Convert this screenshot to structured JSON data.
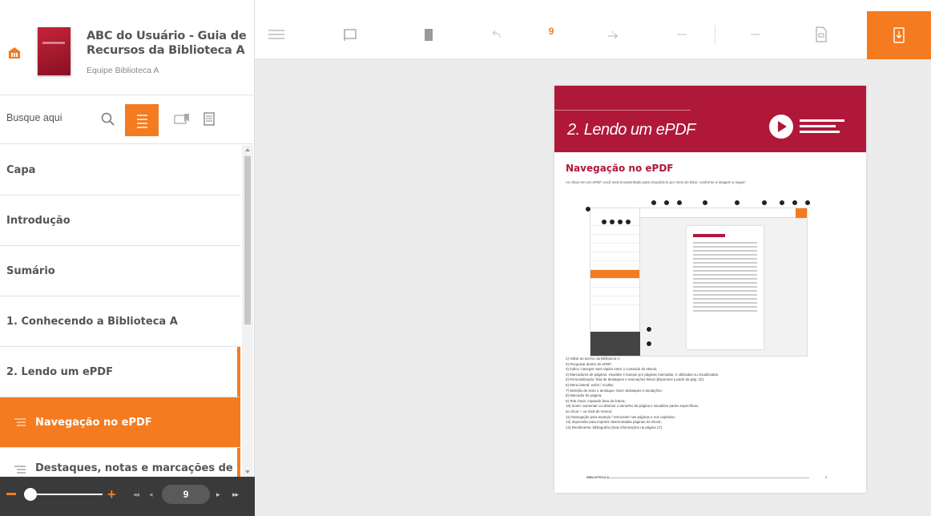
{
  "book": {
    "title": "ABC do Usuário - Guia de Recursos da Biblioteca A",
    "author": "Equipe Biblioteca A"
  },
  "search": {
    "placeholder": "Busque aqui"
  },
  "toc": {
    "items": [
      {
        "label": "Capa"
      },
      {
        "label": "Introdução"
      },
      {
        "label": "Sumário"
      },
      {
        "label": "1. Conhecendo a Biblioteca A"
      },
      {
        "label": "2. Lendo um ePDF"
      },
      {
        "label": "Navegação no ePDF"
      },
      {
        "label": "Destaques, notas e marcações de"
      }
    ]
  },
  "zoom": {
    "minus": "−",
    "plus": "+",
    "nav_first": "◂◂",
    "nav_prev": "◂",
    "nav_next": "▸",
    "nav_last": "▸▸"
  },
  "current_page": "9",
  "colors": {
    "accent": "#f47b20",
    "banner": "#b0183a",
    "sidebar_footer": "#3a3a3a"
  },
  "page": {
    "banner_title": "2. Lendo um ePDF",
    "section_title": "Navegação no ePDF",
    "intro": "Ao clicar em um ePDF, você será encaminhado para visualizá-lo por meio do leitor, conforme a imagem a seguir:",
    "items": [
      "1) Voltar ao acervo da Biblioteca A;",
      "2) Pesquisar dentro do ePDF;",
      "3) Índice: navegar mais rápido entre o conteúdo do eBook;",
      "4) Marcadores de páginas: visualize e busque por páginas marcadas, e utilizadas ou visualizadas;",
      "5) Personalização: lista de destaques e marcações feitos (disponível a partir da pág. 10);",
      "6) Menu lateral: exibir / ocultar;",
      "7) Seleção de texto e destaque: fazer destaques e anotações;",
      "8) Marcador de página;",
      "9) Tela cheia: expandir área de leitura;",
      "10) Zoom: aumentar ou diminuir o tamanho da página e visualizar partes específicas;",
      "     ao clicar + ou sinal de menos;",
      "11) Navegação para avançar / retroceder nas páginas e nos capítulos;",
      "12) Impressão para imprimir determinadas páginas do ebook;",
      "13) Rendimento: bibliografia (mais informações na página 17)."
    ],
    "footer_brand": "BIBLIOTECA A",
    "footer_page": "9"
  }
}
